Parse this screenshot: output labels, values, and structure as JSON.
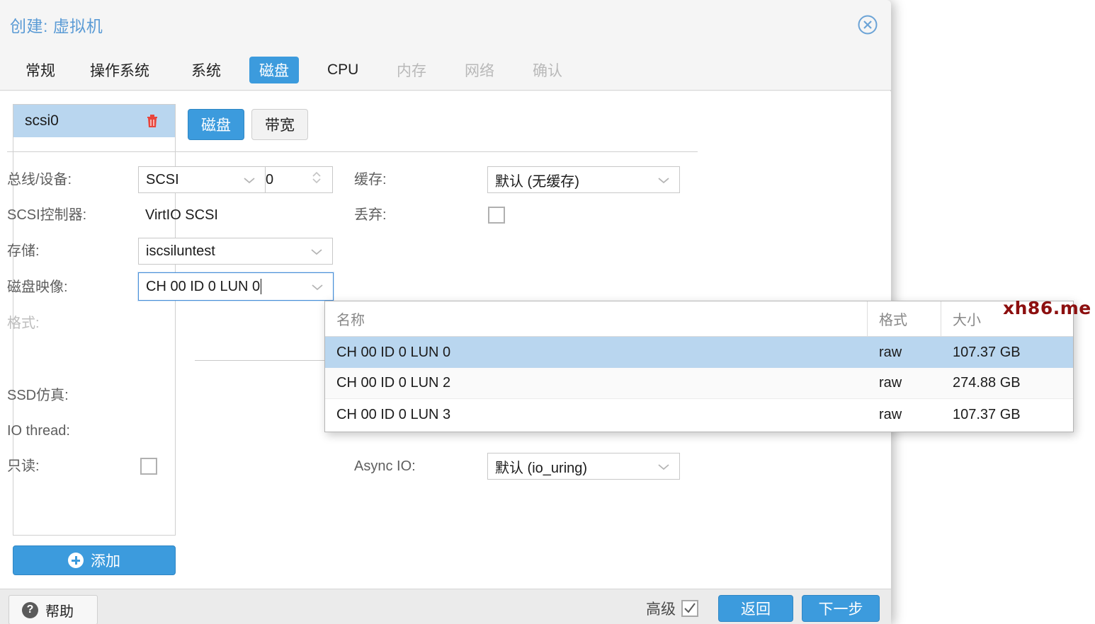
{
  "dialog": {
    "title": "创建: 虚拟机",
    "close_icon": "close-circle-icon"
  },
  "tabs": [
    {
      "label": "常规",
      "state": "normal"
    },
    {
      "label": "操作系统",
      "state": "normal"
    },
    {
      "label": "系统",
      "state": "normal"
    },
    {
      "label": "磁盘",
      "state": "active"
    },
    {
      "label": "CPU",
      "state": "normal"
    },
    {
      "label": "内存",
      "state": "disabled"
    },
    {
      "label": "网络",
      "state": "disabled"
    },
    {
      "label": "确认",
      "state": "disabled"
    }
  ],
  "sidebar": {
    "items": [
      {
        "label": "scsi0",
        "selected": true,
        "delete_icon": "trash-icon"
      }
    ],
    "add_button": {
      "label": "添加",
      "icon": "plus-circle-icon"
    }
  },
  "subtabs": [
    {
      "label": "磁盘",
      "active": true
    },
    {
      "label": "带宽",
      "active": false
    }
  ],
  "form": {
    "bus_device": {
      "label": "总线/设备:",
      "bus_value": "SCSI",
      "device_value": "0"
    },
    "scsi_controller": {
      "label": "SCSI控制器:",
      "value": "VirtIO SCSI"
    },
    "storage": {
      "label": "存储:",
      "value": "iscsiluntest"
    },
    "disk_image": {
      "label": "磁盘映像:",
      "value": "CH 00 ID 0 LUN 0",
      "focused": true
    },
    "format": {
      "label": "格式:",
      "value": "",
      "disabled": true
    },
    "ssd_emulation": {
      "label": "SSD仿真:"
    },
    "io_thread": {
      "label": "IO thread:"
    },
    "readonly": {
      "label": "只读:",
      "checked": false
    },
    "cache": {
      "label": "缓存:",
      "value": "默认 (无缓存)"
    },
    "discard": {
      "label": "丢弃:",
      "checked": false
    },
    "async_io": {
      "label": "Async IO:",
      "value": "默认 (io_uring)"
    }
  },
  "picker": {
    "columns": [
      {
        "key": "name",
        "label": "名称"
      },
      {
        "key": "format",
        "label": "格式"
      },
      {
        "key": "size",
        "label": "大小"
      }
    ],
    "rows": [
      {
        "name": "CH 00 ID 0 LUN 0",
        "format": "raw",
        "size": "107.37 GB",
        "selected": true
      },
      {
        "name": "CH 00 ID 0 LUN 2",
        "format": "raw",
        "size": "274.88 GB",
        "selected": false
      },
      {
        "name": "CH 00 ID 0 LUN 3",
        "format": "raw",
        "size": "107.37 GB",
        "selected": false
      }
    ]
  },
  "watermark": {
    "text": "xh86.me",
    "color": "#8c0f0f"
  },
  "footer": {
    "help": {
      "label": "帮助",
      "icon": "question-circle-icon"
    },
    "advanced": {
      "label": "高级",
      "checked": true
    },
    "back": "返回",
    "next": "下一步"
  },
  "colors": {
    "accent": "#3c9bdd",
    "title": "#5b9bd5",
    "selection": "#b9d6ef",
    "trash": "#e8453c"
  }
}
